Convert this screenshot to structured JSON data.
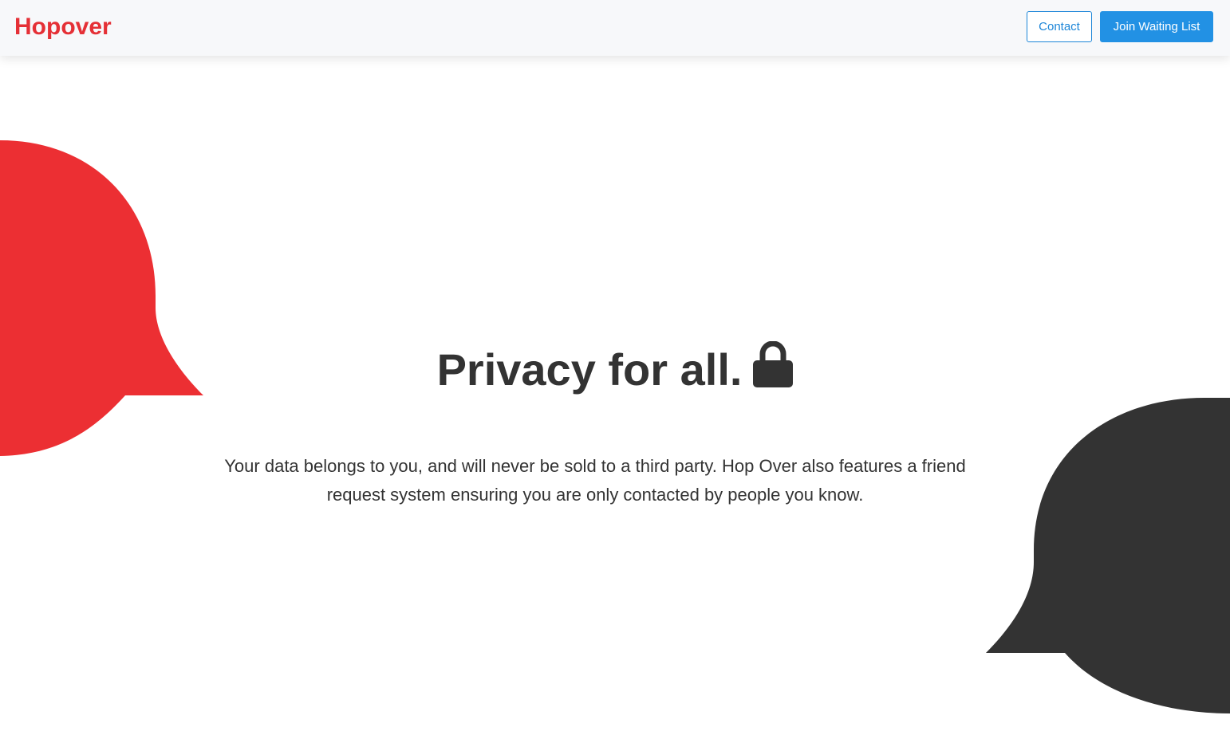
{
  "header": {
    "logo_text": "Hopover",
    "contact_label": "Contact",
    "join_label": "Join Waiting List"
  },
  "hero": {
    "title": "Privacy for all.",
    "title_icon": "lock-icon",
    "description": "Your data belongs to you, and will never be sold to a third party. Hop Over also features a friend request system ensuring you are only contacted by people you know."
  },
  "colors": {
    "brand_red": "#e53036",
    "accent_blue": "#2291e4",
    "dark": "#333333",
    "nav_background": "#f7f8fa"
  }
}
